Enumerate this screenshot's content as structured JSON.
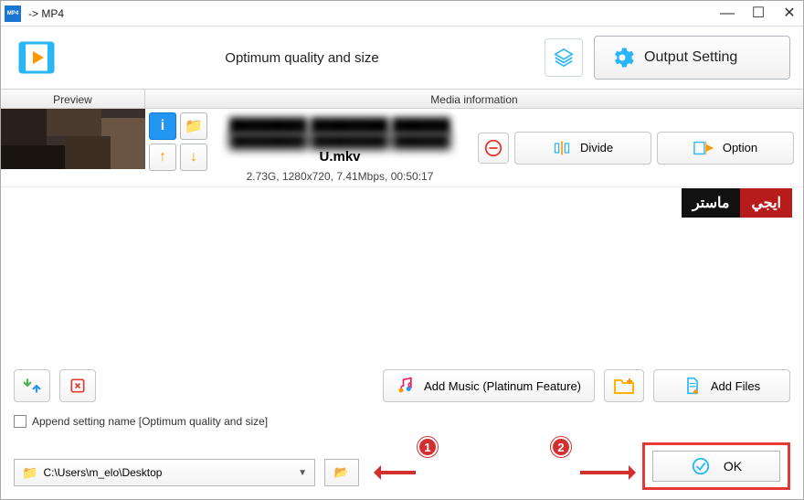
{
  "window": {
    "title": "-> MP4"
  },
  "topbar": {
    "quality_label": "Optimum quality and size",
    "output_setting_label": "Output Setting"
  },
  "columns": {
    "preview": "Preview",
    "media": "Media information"
  },
  "file": {
    "name_blurred": "████████ ████████ ██████",
    "name_tail": "U.mkv",
    "meta": "2.73G, 1280x720, 7.41Mbps, 00:50:17"
  },
  "row_buttons": {
    "divide": "Divide",
    "option": "Option"
  },
  "watermark": {
    "part1": "ماستر",
    "part2": "ايجي"
  },
  "bottom": {
    "add_music": "Add Music (Platinum Feature)",
    "add_files": "Add Files",
    "append_label": "Append setting name [Optimum quality and size]",
    "output_path": "C:\\Users\\m_elo\\Desktop",
    "ok": "OK"
  },
  "callouts": {
    "one": "1",
    "two": "2"
  }
}
